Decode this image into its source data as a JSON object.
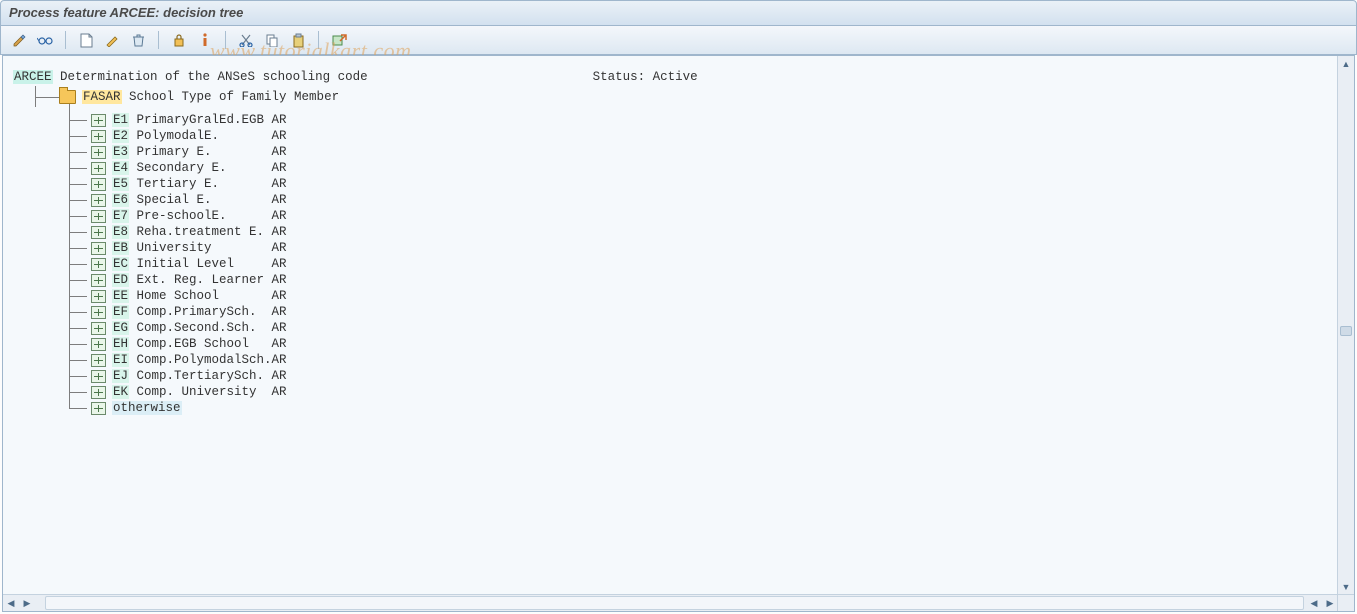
{
  "title": "Process feature ARCEE: decision tree",
  "watermark": "www.tutorialkart.com",
  "toolbar_icons": [
    "edit-icon",
    "glasses-icon",
    "sep",
    "new-icon",
    "pencil-icon",
    "delete-icon",
    "sep",
    "lock-icon",
    "info-icon",
    "sep",
    "cut-icon",
    "copy-icon",
    "paste-icon",
    "sep",
    "export-icon"
  ],
  "root": {
    "code": "ARCEE",
    "description": "Determination of the ANSeS schooling code",
    "status_label": "Status:",
    "status_value": "Active"
  },
  "folder": {
    "code": "FASAR",
    "description": "School Type of Family Member"
  },
  "items": [
    {
      "code": "E1",
      "desc": "PrimaryGralEd.EGB",
      "suffix": "AR"
    },
    {
      "code": "E2",
      "desc": "PolymodalE.",
      "suffix": "AR"
    },
    {
      "code": "E3",
      "desc": "Primary E.",
      "suffix": "AR"
    },
    {
      "code": "E4",
      "desc": "Secondary E.",
      "suffix": "AR"
    },
    {
      "code": "E5",
      "desc": "Tertiary E.",
      "suffix": "AR"
    },
    {
      "code": "E6",
      "desc": "Special E.",
      "suffix": "AR"
    },
    {
      "code": "E7",
      "desc": "Pre-schoolE.",
      "suffix": "AR"
    },
    {
      "code": "E8",
      "desc": "Reha.treatment E.",
      "suffix": "AR"
    },
    {
      "code": "EB",
      "desc": "University",
      "suffix": "AR"
    },
    {
      "code": "EC",
      "desc": "Initial Level",
      "suffix": "AR"
    },
    {
      "code": "ED",
      "desc": "Ext. Reg. Learner",
      "suffix": "AR"
    },
    {
      "code": "EE",
      "desc": "Home School",
      "suffix": "AR"
    },
    {
      "code": "EF",
      "desc": "Comp.PrimarySch.",
      "suffix": "AR"
    },
    {
      "code": "EG",
      "desc": "Comp.Second.Sch.",
      "suffix": "AR"
    },
    {
      "code": "EH",
      "desc": "Comp.EGB School",
      "suffix": "AR"
    },
    {
      "code": "EI",
      "desc": "Comp.PolymodalSch.",
      "suffix": "AR"
    },
    {
      "code": "EJ",
      "desc": "Comp.TertiarySch.",
      "suffix": "AR"
    },
    {
      "code": "EK",
      "desc": "Comp. University",
      "suffix": "AR"
    },
    {
      "code": "otherwise",
      "desc": "",
      "suffix": ""
    }
  ]
}
